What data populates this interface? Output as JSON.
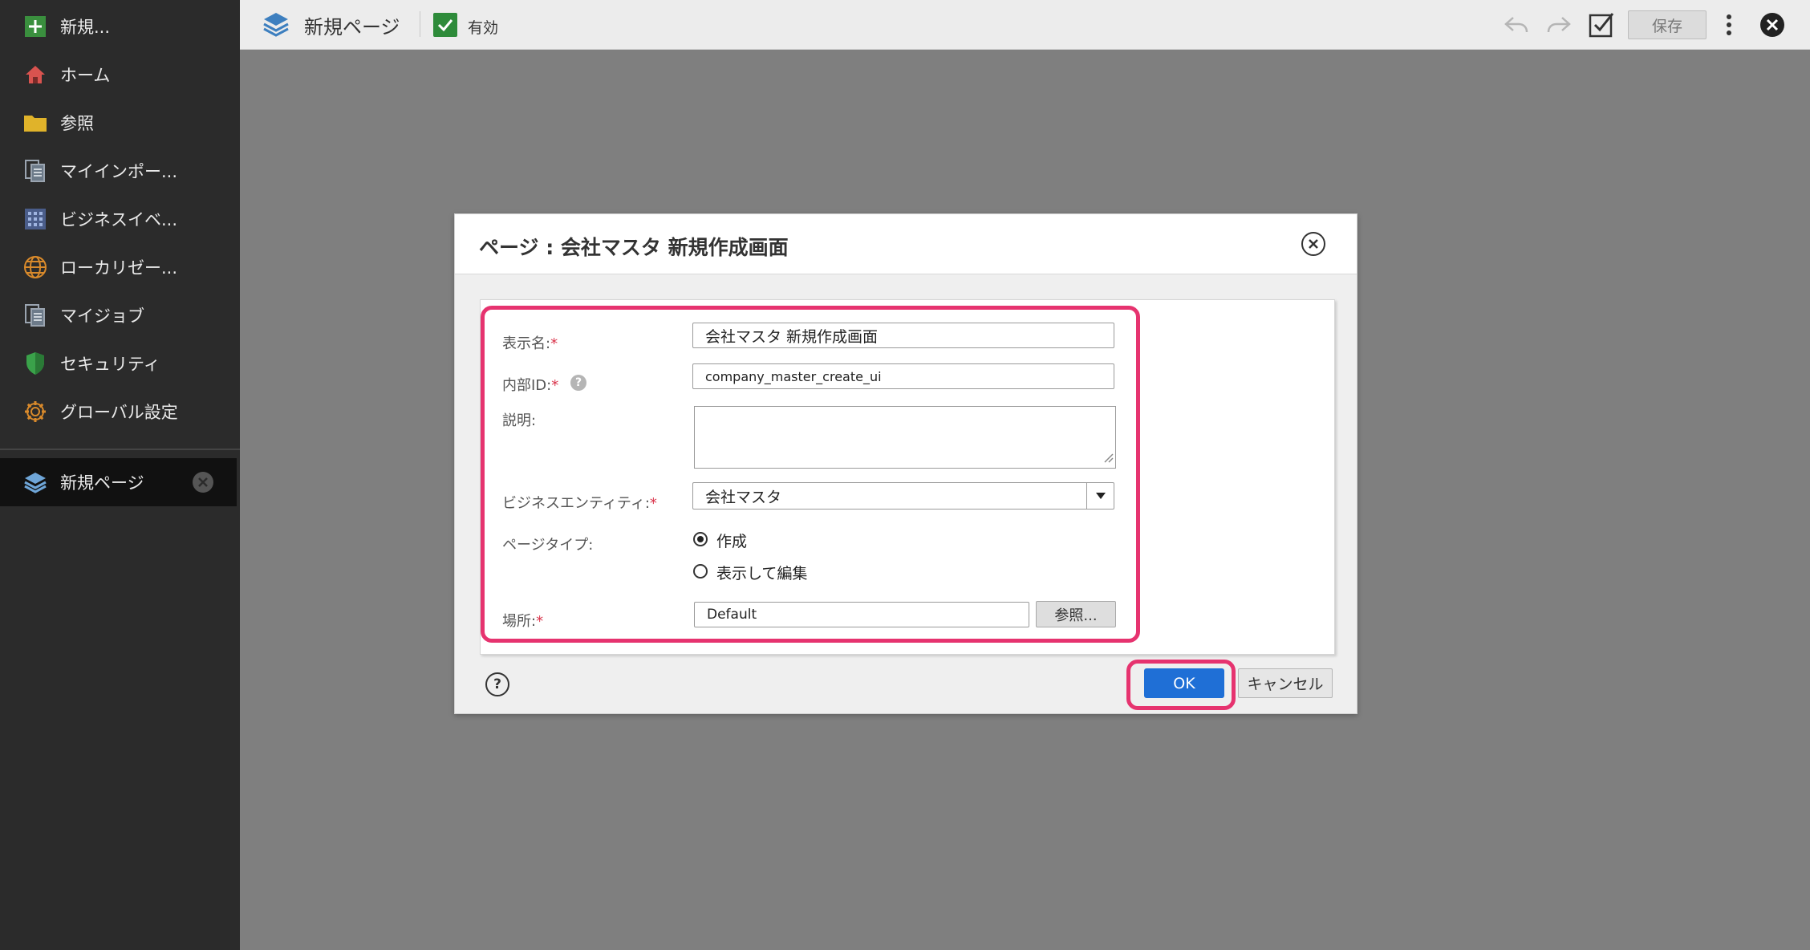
{
  "sidebar": {
    "items": [
      {
        "label": "新規...",
        "icon": "plus-icon"
      },
      {
        "label": "ホーム",
        "icon": "home-icon"
      },
      {
        "label": "参照",
        "icon": "folder-icon"
      },
      {
        "label": "マイインポー...",
        "icon": "document-icon"
      },
      {
        "label": "ビジネスイベ...",
        "icon": "grid-icon"
      },
      {
        "label": "ローカリゼー...",
        "icon": "globe-icon"
      },
      {
        "label": "マイジョブ",
        "icon": "document-icon"
      },
      {
        "label": "セキュリティ",
        "icon": "shield-icon"
      },
      {
        "label": "グローバル設定",
        "icon": "gear-icon"
      }
    ],
    "open_tab": {
      "label": "新規ページ",
      "icon": "layers-icon"
    }
  },
  "toolbar": {
    "title": "新規ページ",
    "enabled_label": "有効",
    "save_label": "保存"
  },
  "dialog": {
    "title": "ページ : 会社マスタ 新規作成画面",
    "required_mark": "*",
    "display_name": {
      "label": "表示名:",
      "value": "会社マスタ 新規作成画面"
    },
    "internal_id": {
      "label": "内部ID:",
      "value": "company_master_create_ui",
      "help": "?"
    },
    "description": {
      "label": "説明:",
      "value": ""
    },
    "business_entity": {
      "label": "ビジネスエンティティ:",
      "value": "会社マスタ"
    },
    "page_type": {
      "label": "ページタイプ:",
      "options": [
        {
          "label": "作成",
          "selected": true
        },
        {
          "label": "表示して編集",
          "selected": false
        }
      ]
    },
    "location": {
      "label": "場所:",
      "value": "Default",
      "browse_label": "参照..."
    },
    "help_label": "?",
    "ok_label": "OK",
    "cancel_label": "キャンセル"
  },
  "colors": {
    "sidebar_bg": "#2b2b2b",
    "primary_button": "#1f6fd6",
    "highlight": "#e6336f",
    "enabled_check": "#2e8b3a"
  }
}
